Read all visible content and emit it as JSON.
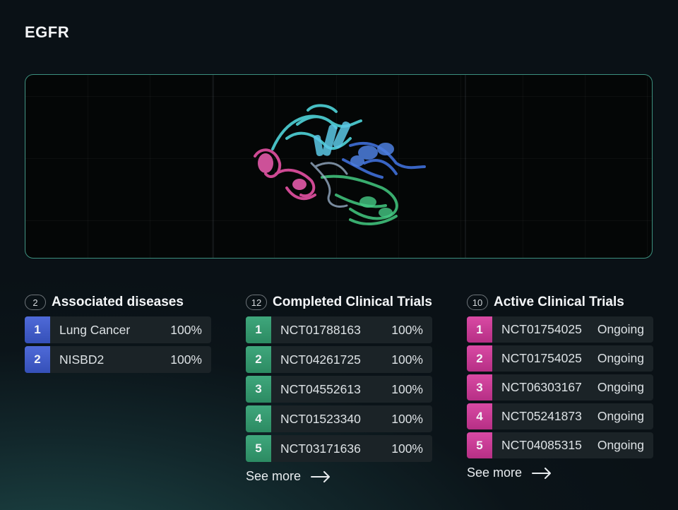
{
  "title": "EGFR",
  "viewer": {
    "icon": "protein-structure-3d"
  },
  "associated": {
    "count": "2",
    "title": "Associated diseases",
    "items": [
      {
        "num": "1",
        "name": "Lung Cancer",
        "value": "100%"
      },
      {
        "num": "2",
        "name": "NISBD2",
        "value": "100%"
      }
    ]
  },
  "completed": {
    "count": "12",
    "title": "Completed Clinical Trials",
    "items": [
      {
        "num": "1",
        "name": "NCT01788163",
        "value": "100%"
      },
      {
        "num": "2",
        "name": "NCT04261725",
        "value": "100%"
      },
      {
        "num": "3",
        "name": "NCT04552613",
        "value": "100%"
      },
      {
        "num": "4",
        "name": "NCT01523340",
        "value": "100%"
      },
      {
        "num": "5",
        "name": "NCT03171636",
        "value": "100%"
      }
    ],
    "see_more": "See more"
  },
  "active": {
    "count": "10",
    "title": "Active Clinical Trials",
    "items": [
      {
        "num": "1",
        "name": "NCT01754025",
        "value": "Ongoing"
      },
      {
        "num": "2",
        "name": "NCT01754025",
        "value": "Ongoing"
      },
      {
        "num": "3",
        "name": "NCT06303167",
        "value": "Ongoing"
      },
      {
        "num": "4",
        "name": "NCT05241873",
        "value": "Ongoing"
      },
      {
        "num": "5",
        "name": "NCT04085315",
        "value": "Ongoing"
      }
    ],
    "see_more": "See more"
  },
  "colors": {
    "blue": "#4f6ad8",
    "green": "#3fa77c",
    "pink": "#d94aa4",
    "border": "#3c8f7e"
  }
}
